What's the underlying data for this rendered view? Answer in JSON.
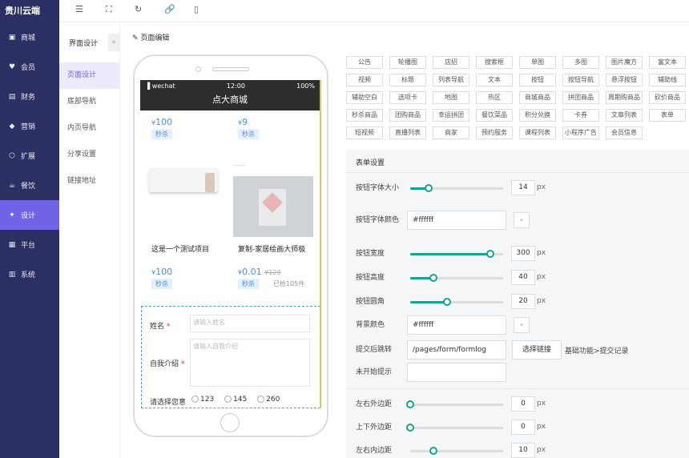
{
  "sidebar": {
    "brand": "贵川云端",
    "items": [
      {
        "label": "商城",
        "icon": "shop-icon"
      },
      {
        "label": "会员",
        "icon": "member-icon"
      },
      {
        "label": "财务",
        "icon": "finance-icon"
      },
      {
        "label": "营销",
        "icon": "marketing-icon"
      },
      {
        "label": "扩展",
        "icon": "extend-icon"
      },
      {
        "label": "餐饮",
        "icon": "food-icon"
      },
      {
        "label": "设计",
        "icon": "design-icon"
      },
      {
        "label": "平台",
        "icon": "platform-icon"
      },
      {
        "label": "系统",
        "icon": "system-icon"
      }
    ]
  },
  "subnav": {
    "title": "界面设计",
    "collapse": "«",
    "items": [
      "页面设计",
      "底部导航",
      "内页导航",
      "分享设置",
      "链接地址"
    ]
  },
  "page_title": "页面编辑",
  "phone": {
    "status_left": "wechat",
    "time": "12:00",
    "battery": "100%",
    "shop_title": "点大商城",
    "goods": [
      {
        "price": "100",
        "tag": "秒杀"
      },
      {
        "price": "9",
        "tag": "秒杀"
      },
      {
        "name": "这是一个测试项目",
        "price": "100",
        "tag": "秒杀"
      },
      {
        "name": "复制-家居绘画大师极",
        "price": "0.01",
        "old": "129",
        "tag": "秒杀",
        "sold": "已抢105件"
      }
    ],
    "currency": "¥",
    "form": {
      "name_label": "姓名",
      "name_placeholder": "请输入姓名",
      "intro_label": "自我介绍",
      "intro_placeholder": "请输入自我介绍",
      "choice_label": "请选择您意",
      "options": [
        "123",
        "145",
        "260"
      ]
    }
  },
  "components": [
    [
      "公告",
      "轮播图",
      "店招",
      "搜索框",
      "单图",
      "多图",
      "图片魔方",
      "富文本"
    ],
    [
      "视频",
      "标题",
      "列表导航",
      "文本",
      "按钮",
      "按钮导航",
      "悬浮按钮",
      "辅助线"
    ],
    [
      "辅助空白",
      "选项卡",
      "地图",
      "热区",
      "商城商品",
      "拼团商品",
      "周期购商品",
      "砍价商品"
    ],
    [
      "秒杀商品",
      "团购商品",
      "幸运拼团",
      "餐饮菜品",
      "积分兑换",
      "卡券",
      "文章列表",
      "表单"
    ],
    [
      "短视频",
      "直播列表",
      "商家",
      "预约服务",
      "课程列表",
      "小程序广告",
      "会员信息"
    ]
  ],
  "settings": {
    "title": "表单设置",
    "font_size_label": "按钮字体大小",
    "font_size": "14",
    "font_size_level": 0.2,
    "font_color_label": "按钮字体颜色",
    "font_color": "#ffffff",
    "width_label": "按钮宽度",
    "width": "300",
    "width_level": 0.86,
    "height_label": "按钮高度",
    "height": "40",
    "height_level": 0.25,
    "radius_label": "按钮圆角",
    "radius": "20",
    "radius_level": 0.4,
    "bg_label": "背景颜色",
    "bg_color": "#ffffff",
    "jump_label": "提交后跳转",
    "jump_value": "/pages/form/formlog",
    "choose_link": "选择链接",
    "jump_note": "基础功能>提交记录",
    "not_started_label": "未开始提示",
    "margin_lr_label": "左右外边距",
    "margin_lr": "0",
    "margin_tb_label": "上下外边距",
    "margin_tb": "0",
    "padding_lr_label": "左右内边距",
    "padding_lr": "10",
    "unit": "px"
  },
  "colors": {
    "sidebar": "#2b2f62",
    "accent": "#6f63e6",
    "slider": "#14a68a",
    "price": "#4a8fe0"
  }
}
